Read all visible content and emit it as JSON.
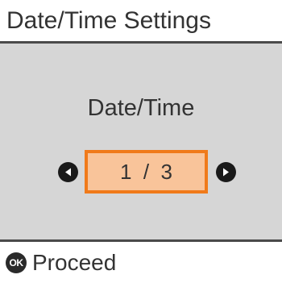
{
  "header": {
    "title": "Date/Time Settings"
  },
  "main": {
    "item_label": "Date/Time",
    "pager": {
      "text": "1  /  3",
      "current": 1,
      "total": 3
    },
    "icons": {
      "prev": "left-arrow-icon",
      "next": "right-arrow-icon"
    }
  },
  "footer": {
    "ok_icon_text": "OK",
    "action_label": "Proceed"
  },
  "colors": {
    "panel_bg": "#d6d6d6",
    "highlight_fill": "#f9c49a",
    "highlight_border": "#f07a1a",
    "text": "#333333",
    "divider": "#4a4a4a"
  }
}
